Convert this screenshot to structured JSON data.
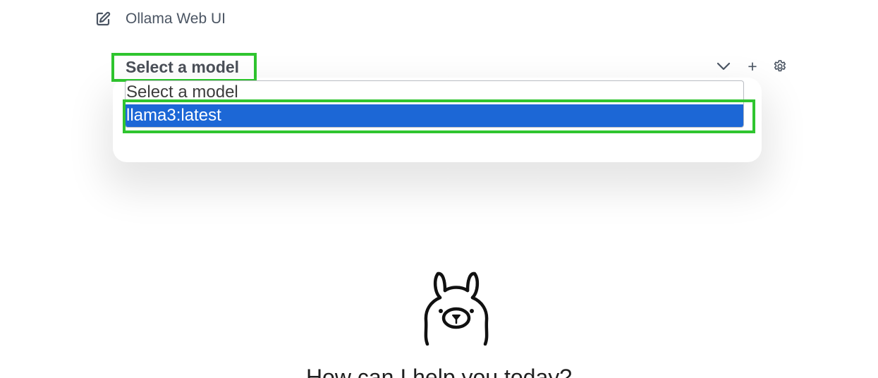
{
  "header": {
    "title": "Ollama Web UI",
    "new_chat_icon": "edit-square-icon"
  },
  "model_selector": {
    "selected_label": "Select a model",
    "options": [
      {
        "label": "Select a model",
        "highlighted": false
      },
      {
        "label": "llama3:latest",
        "highlighted": true
      }
    ],
    "icons": {
      "expand": "chevron-down-icon",
      "add": "plus-icon",
      "settings": "gear-icon"
    }
  },
  "main": {
    "logo": "ollama-llama-logo",
    "greeting": "How can I help you today?"
  },
  "colors": {
    "highlight_outline": "#2fc52f",
    "selected_option_bg": "#1c67d6",
    "selected_option_text": "#ffffff",
    "text": "#4b5563"
  }
}
